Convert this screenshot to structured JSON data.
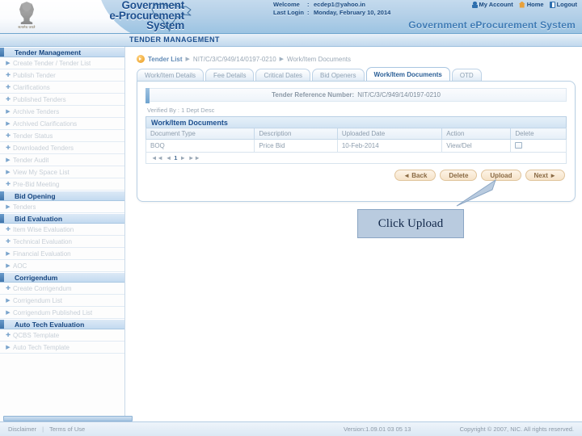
{
  "header": {
    "brand_line1": "Government",
    "brand_line2": "e-Procurement",
    "brand_line3": "System",
    "emblem_caption": "सत्यमेव जयते",
    "welcome_label": "Welcome",
    "lastlogin_label": "Last Login",
    "colon": ":",
    "welcome_value": "ecdep1@yahoo.in",
    "lastlogin_value": "Monday, February 10, 2014",
    "links": [
      {
        "label": "My Account",
        "icon": "user-icon"
      },
      {
        "label": "Home",
        "icon": "home-icon"
      },
      {
        "label": "Logout",
        "icon": "logout-icon"
      }
    ],
    "site_title": "Government eProcurement System"
  },
  "page_band": {
    "title": "TENDER MANAGEMENT"
  },
  "sidebar": {
    "groups": [
      {
        "title": "Tender Management",
        "items": [
          {
            "label": "Create Tender / Tender List",
            "arrow": "▶"
          },
          {
            "label": "Publish Tender",
            "arrow": "✚"
          },
          {
            "label": "Clarifications",
            "arrow": "✚"
          },
          {
            "label": "Published Tenders",
            "arrow": "✚"
          },
          {
            "label": "Archive Tenders",
            "arrow": "▶"
          },
          {
            "label": "Archived Clarifications",
            "arrow": "▶"
          },
          {
            "label": "Tender Status",
            "arrow": "✚"
          },
          {
            "label": "Downloaded Tenders",
            "arrow": "✚"
          },
          {
            "label": "Tender Audit",
            "arrow": "▶"
          },
          {
            "label": "View My Space List",
            "arrow": "▶"
          },
          {
            "label": "Pre-Bid Meeting",
            "arrow": "✚"
          }
        ]
      },
      {
        "title": "Bid Opening",
        "items": [
          {
            "label": "Tenders",
            "arrow": "▶"
          }
        ]
      },
      {
        "title": "Bid Evaluation",
        "items": [
          {
            "label": "Item Wise Evaluation",
            "arrow": "✚"
          },
          {
            "label": "Technical Evaluation",
            "arrow": "✚"
          },
          {
            "label": "Financial Evaluation",
            "arrow": "▶"
          },
          {
            "label": "AOC",
            "arrow": "▶"
          }
        ]
      },
      {
        "title": "Corrigendum",
        "items": [
          {
            "label": "Create Corrigendum",
            "arrow": "✚"
          },
          {
            "label": "Corrigendum List",
            "arrow": "▶"
          },
          {
            "label": "Corrigendum Published List",
            "arrow": "▶"
          }
        ]
      },
      {
        "title": "Auto Tech Evaluation",
        "items": [
          {
            "label": "QCBS Template",
            "arrow": "✚"
          },
          {
            "label": "Auto Tech Template",
            "arrow": "▶"
          }
        ]
      }
    ]
  },
  "breadcrumb": {
    "root": "Tender List",
    "sep": "▶",
    "tender_id": "NIT/C/3/C/949/14/0197-0210",
    "current": "Work/Item Documents"
  },
  "tabs": [
    {
      "label": "Work/Item Details",
      "active": false
    },
    {
      "label": "Fee Details",
      "active": false
    },
    {
      "label": "Critical Dates",
      "active": false
    },
    {
      "label": "Bid Openers",
      "active": false
    },
    {
      "label": "Work/Item Documents",
      "active": true
    },
    {
      "label": "OTD",
      "active": false
    }
  ],
  "panel": {
    "ref_label": "Tender Reference Number",
    "ref_colon": ":",
    "ref_value": "NIT/C/3/C/949/14/0197-0210",
    "verified_text": "Verified By : 1 Dept Desc",
    "table_title": "Work/Item Documents",
    "columns": [
      "Document Type",
      "Description",
      "Uploaded Date",
      "Action",
      "Delete"
    ],
    "rows": [
      {
        "document_type": "BOQ",
        "description": "Price Bid",
        "uploaded_date": "10-Feb-2014",
        "action": "View/Del",
        "delete_checked": false
      }
    ],
    "pager": {
      "first": "◄◄",
      "prev": "◄",
      "page": "1",
      "next": "►",
      "last": "►►"
    },
    "buttons": [
      {
        "label": "◄ Back",
        "name": "back-button"
      },
      {
        "label": "Delete",
        "name": "delete-button"
      },
      {
        "label": "Upload",
        "name": "upload-button"
      },
      {
        "label": "Next ►",
        "name": "next-button"
      }
    ]
  },
  "callout": {
    "text": "Click Upload"
  },
  "footer": {
    "disclaimer": "Disclaimer",
    "sep": "|",
    "terms": "Terms of Use",
    "version": "Version:1.09.01 03 05 13",
    "copyright": "Copyright © 2007, NIC. All rights reserved."
  }
}
